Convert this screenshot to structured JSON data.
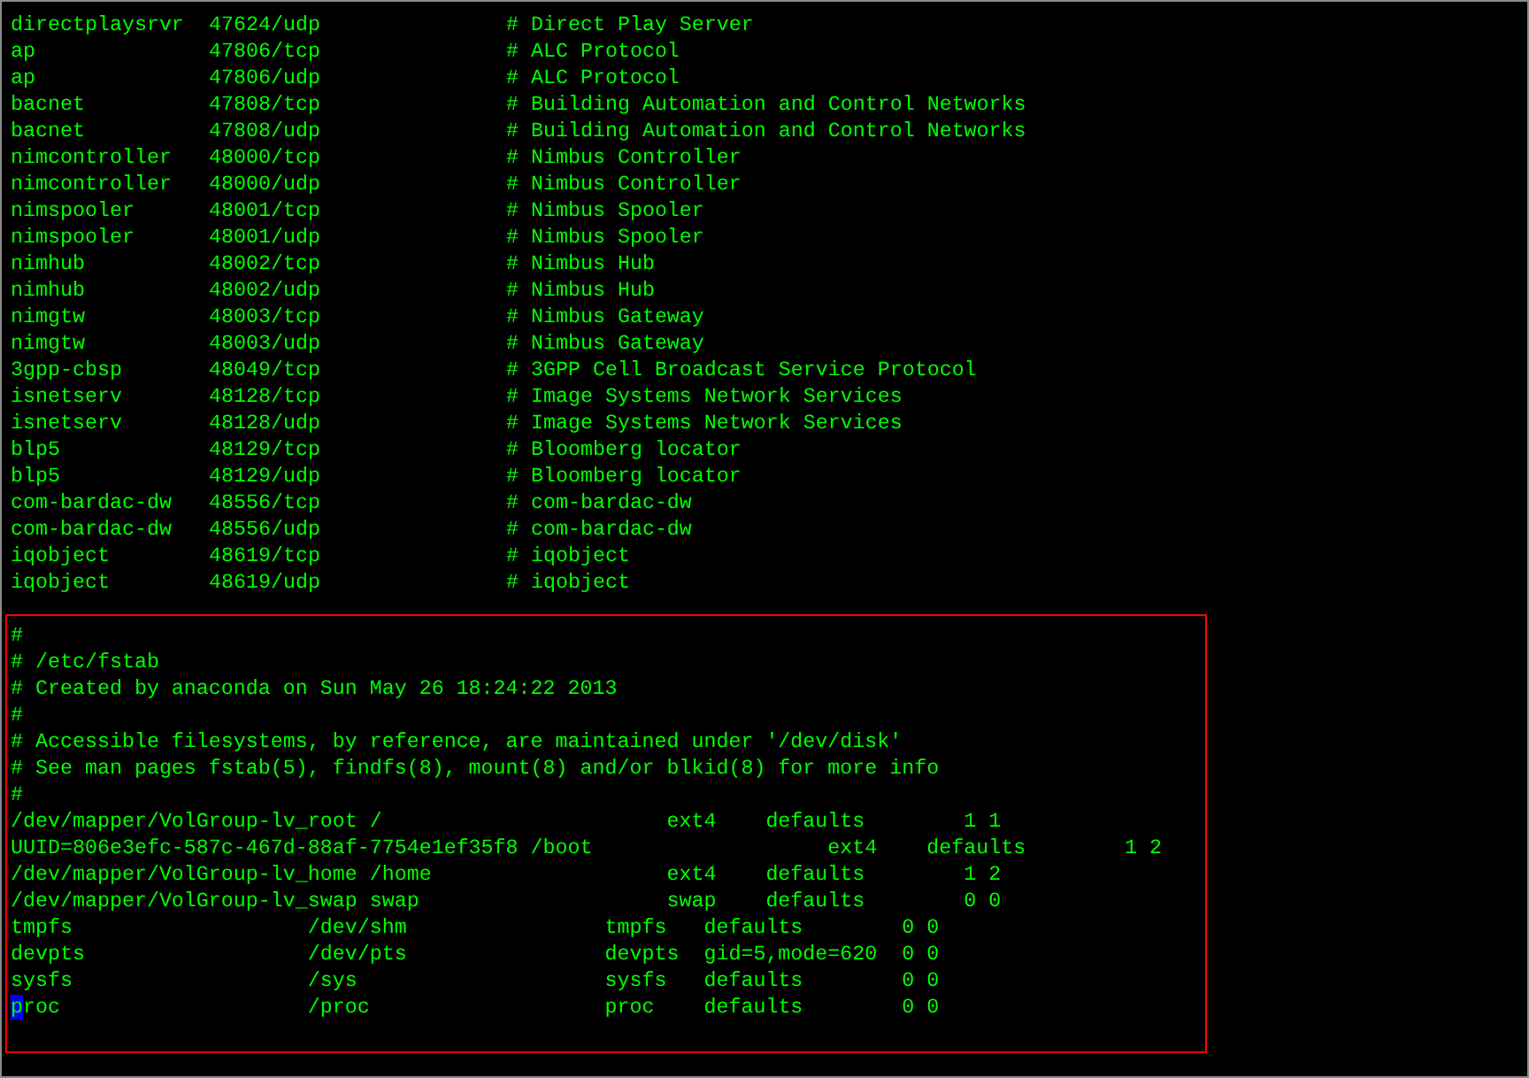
{
  "services": [
    {
      "name": "directplaysrvr",
      "port": "47624/udp",
      "comment": "# Direct Play Server"
    },
    {
      "name": "ap",
      "port": "47806/tcp",
      "comment": "# ALC Protocol"
    },
    {
      "name": "ap",
      "port": "47806/udp",
      "comment": "# ALC Protocol"
    },
    {
      "name": "bacnet",
      "port": "47808/tcp",
      "comment": "# Building Automation and Control Networks"
    },
    {
      "name": "bacnet",
      "port": "47808/udp",
      "comment": "# Building Automation and Control Networks"
    },
    {
      "name": "nimcontroller",
      "port": "48000/tcp",
      "comment": "# Nimbus Controller"
    },
    {
      "name": "nimcontroller",
      "port": "48000/udp",
      "comment": "# Nimbus Controller"
    },
    {
      "name": "nimspooler",
      "port": "48001/tcp",
      "comment": "# Nimbus Spooler"
    },
    {
      "name": "nimspooler",
      "port": "48001/udp",
      "comment": "# Nimbus Spooler"
    },
    {
      "name": "nimhub",
      "port": "48002/tcp",
      "comment": "# Nimbus Hub"
    },
    {
      "name": "nimhub",
      "port": "48002/udp",
      "comment": "# Nimbus Hub"
    },
    {
      "name": "nimgtw",
      "port": "48003/tcp",
      "comment": "# Nimbus Gateway"
    },
    {
      "name": "nimgtw",
      "port": "48003/udp",
      "comment": "# Nimbus Gateway"
    },
    {
      "name": "3gpp-cbsp",
      "port": "48049/tcp",
      "comment": "# 3GPP Cell Broadcast Service Protocol"
    },
    {
      "name": "isnetserv",
      "port": "48128/tcp",
      "comment": "# Image Systems Network Services"
    },
    {
      "name": "isnetserv",
      "port": "48128/udp",
      "comment": "# Image Systems Network Services"
    },
    {
      "name": "blp5",
      "port": "48129/tcp",
      "comment": "# Bloomberg locator"
    },
    {
      "name": "blp5",
      "port": "48129/udp",
      "comment": "# Bloomberg locator"
    },
    {
      "name": "com-bardac-dw",
      "port": "48556/tcp",
      "comment": "# com-bardac-dw"
    },
    {
      "name": "com-bardac-dw",
      "port": "48556/udp",
      "comment": "# com-bardac-dw"
    },
    {
      "name": "iqobject",
      "port": "48619/tcp",
      "comment": "# iqobject"
    },
    {
      "name": "iqobject",
      "port": "48619/udp",
      "comment": "# iqobject"
    }
  ],
  "fstab": [
    {
      "text": "#",
      "cursor": false
    },
    {
      "text": "# /etc/fstab",
      "cursor": false
    },
    {
      "text": "# Created by anaconda on Sun May 26 18:24:22 2013",
      "cursor": false
    },
    {
      "text": "#",
      "cursor": false
    },
    {
      "text": "# Accessible filesystems, by reference, are maintained under '/dev/disk'",
      "cursor": false
    },
    {
      "text": "# See man pages fstab(5), findfs(8), mount(8) and/or blkid(8) for more info",
      "cursor": false
    },
    {
      "text": "#",
      "cursor": false
    },
    {
      "text": "/dev/mapper/VolGroup-lv_root /                       ext4    defaults        1 1",
      "cursor": false
    },
    {
      "text": "UUID=806e3efc-587c-467d-88af-7754e1ef35f8 /boot                   ext4    defaults        1 2",
      "cursor": false
    },
    {
      "text": "/dev/mapper/VolGroup-lv_home /home                   ext4    defaults        1 2",
      "cursor": false
    },
    {
      "text": "/dev/mapper/VolGroup-lv_swap swap                    swap    defaults        0 0",
      "cursor": false
    },
    {
      "text": "tmpfs                   /dev/shm                tmpfs   defaults        0 0",
      "cursor": false
    },
    {
      "text": "devpts                  /dev/pts                devpts  gid=5,mode=620  0 0",
      "cursor": false
    },
    {
      "text": "sysfs                   /sys                    sysfs   defaults        0 0",
      "cursor": false
    },
    {
      "text": "proc                    /proc                   proc    defaults        0 0",
      "cursor": true
    }
  ]
}
